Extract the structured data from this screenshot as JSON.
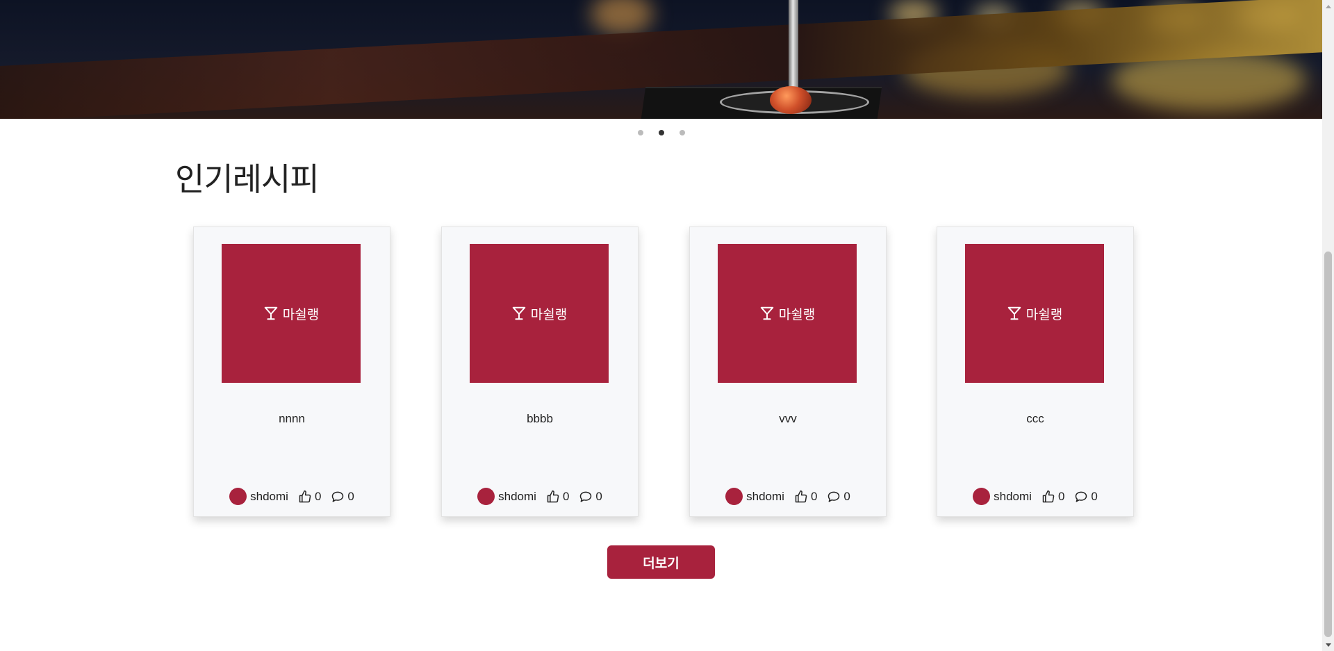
{
  "section": {
    "title": "인기레시피"
  },
  "carousel": {
    "slide_count": 3,
    "active_index": 1
  },
  "brand": {
    "name": "마쉴랭",
    "icon": "cocktail-glass-icon",
    "accent": "#a8223d"
  },
  "cards": [
    {
      "title": "nnnn",
      "author": "shdomi",
      "likes": "0",
      "comments": "0"
    },
    {
      "title": "bbbb",
      "author": "shdomi",
      "likes": "0",
      "comments": "0"
    },
    {
      "title": "vvv",
      "author": "shdomi",
      "likes": "0",
      "comments": "0"
    },
    {
      "title": "ccc",
      "author": "shdomi",
      "likes": "0",
      "comments": "0"
    }
  ],
  "more_button": {
    "label": "더보기"
  }
}
